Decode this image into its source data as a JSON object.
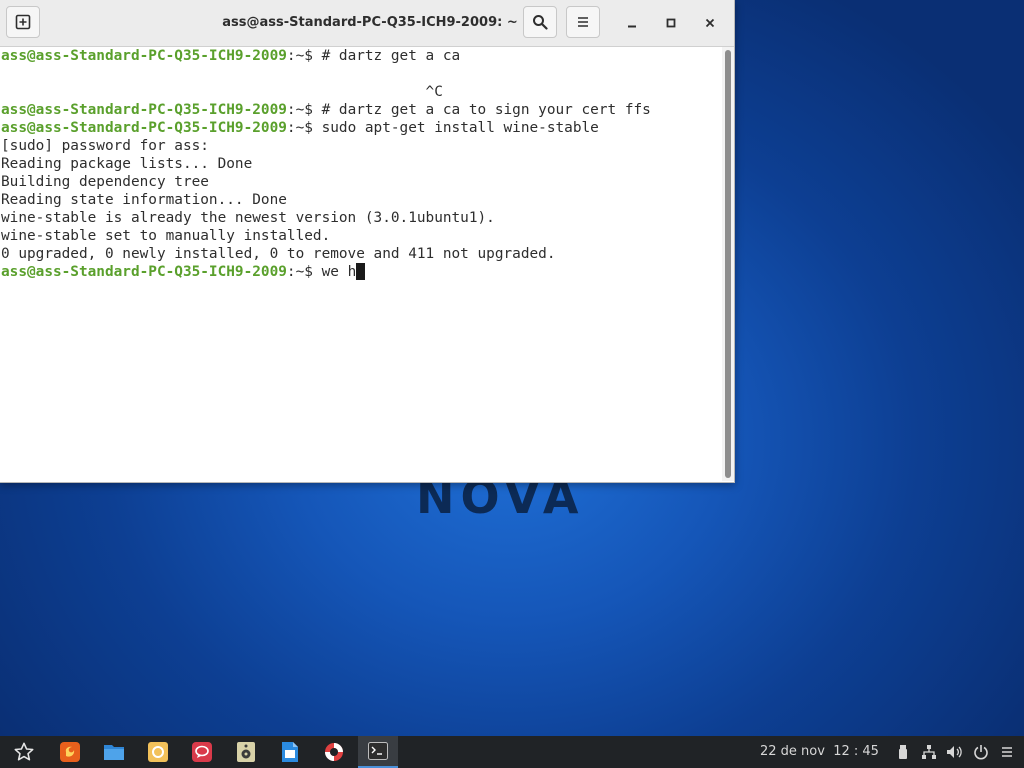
{
  "desktop": {
    "logo_text": "NOVA"
  },
  "window": {
    "title": "ass@ass-Standard-PC-Q35-ICH9-2009: ~"
  },
  "terminal": {
    "lines": [
      {
        "user": "ass@ass-Standard-PC-Q35-ICH9-2009",
        "rest": ":~$ # dartz get a ca"
      },
      {
        "user": "",
        "rest": ""
      },
      {
        "user": "",
        "rest": "                                                 ^C"
      },
      {
        "user": "ass@ass-Standard-PC-Q35-ICH9-2009",
        "rest": ":~$ # dartz get a ca to sign your cert ffs"
      },
      {
        "user": "ass@ass-Standard-PC-Q35-ICH9-2009",
        "rest": ":~$ sudo apt-get install wine-stable"
      },
      {
        "user": "",
        "rest": "[sudo] password for ass:"
      },
      {
        "user": "",
        "rest": "Reading package lists... Done"
      },
      {
        "user": "",
        "rest": "Building dependency tree"
      },
      {
        "user": "",
        "rest": "Reading state information... Done"
      },
      {
        "user": "",
        "rest": "wine-stable is already the newest version (3.0.1ubuntu1)."
      },
      {
        "user": "",
        "rest": "wine-stable set to manually installed."
      },
      {
        "user": "",
        "rest": "0 upgraded, 0 newly installed, 0 to remove and 411 not upgraded."
      },
      {
        "user": "ass@ass-Standard-PC-Q35-ICH9-2009",
        "rest": ":~$ we h"
      }
    ],
    "prompt_color": "#5aa02c"
  },
  "taskbar": {
    "apps": [
      {
        "name": "start-menu",
        "icon": "star-icon"
      },
      {
        "name": "firefox",
        "icon": "firefox-icon"
      },
      {
        "name": "files",
        "icon": "folder-icon"
      },
      {
        "name": "software",
        "icon": "software-icon"
      },
      {
        "name": "chat",
        "icon": "chat-icon"
      },
      {
        "name": "music",
        "icon": "speaker-icon"
      },
      {
        "name": "documents",
        "icon": "document-icon"
      },
      {
        "name": "help",
        "icon": "lifebuoy-icon"
      },
      {
        "name": "terminal",
        "icon": "terminal-icon",
        "active": true
      }
    ],
    "clock": "22 de nov  12 : 45",
    "tray_icons": [
      "usb-icon",
      "network-icon",
      "volume-icon",
      "power-icon",
      "menu-icon"
    ]
  },
  "colors": {
    "accent": "#4a90d9",
    "desktop_bg": "#1556b8",
    "taskbar_bg": "#202326"
  }
}
